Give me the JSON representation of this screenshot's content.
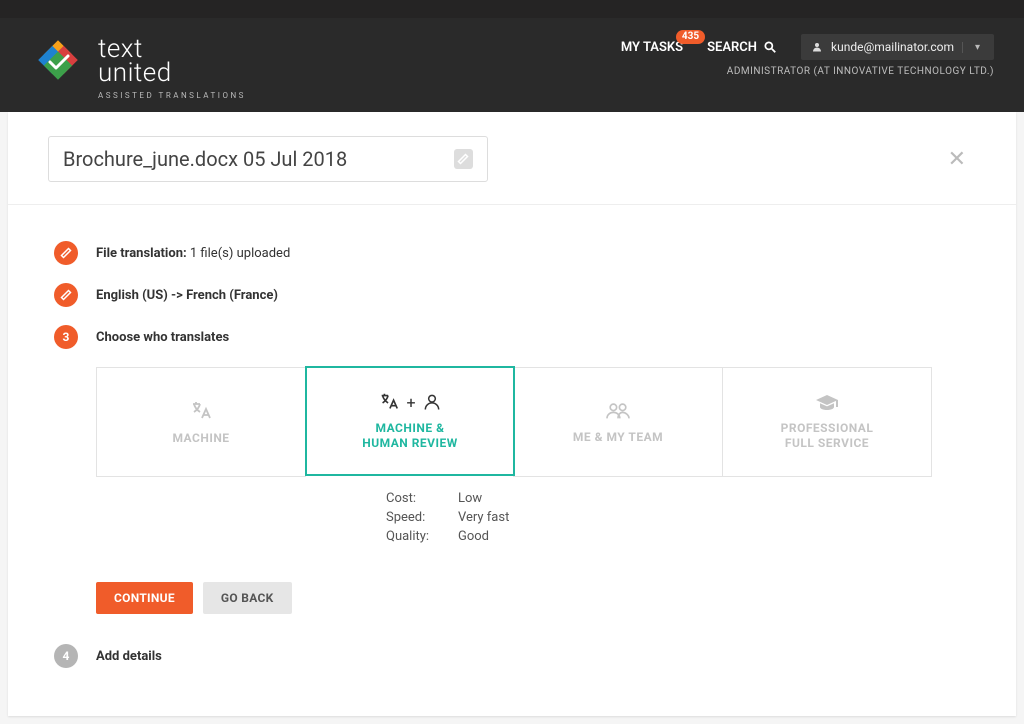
{
  "logo": {
    "line1": "text",
    "line2": "united",
    "tag": "ASSISTED TRANSLATIONS"
  },
  "nav": {
    "mytasks": "MY TASKS",
    "badge": "435",
    "search": "SEARCH"
  },
  "user": {
    "email": "kunde@mailinator.com",
    "subline": "ADMINISTRATOR (AT INNOVATIVE TECHNOLOGY LTD.)"
  },
  "title": "Brochure_june.docx 05 Jul 2018",
  "step1": {
    "prefix": "File translation:",
    "suffix": "1 file(s) uploaded"
  },
  "step2": "English (US) -> French (France)",
  "step3": {
    "num": "3",
    "label": "Choose who translates"
  },
  "options": {
    "a": "MACHINE",
    "b_l1": "MACHINE &",
    "b_l2": "HUMAN REVIEW",
    "c": "ME & MY TEAM",
    "d_l1": "PROFESSIONAL",
    "d_l2": "FULL SERVICE"
  },
  "details": {
    "cost_k": "Cost:",
    "cost_v": "Low",
    "speed_k": "Speed:",
    "speed_v": "Very fast",
    "quality_k": "Quality:",
    "quality_v": "Good"
  },
  "buttons": {
    "continue": "CONTINUE",
    "goback": "GO BACK"
  },
  "step4": {
    "num": "4",
    "label": "Add details"
  }
}
